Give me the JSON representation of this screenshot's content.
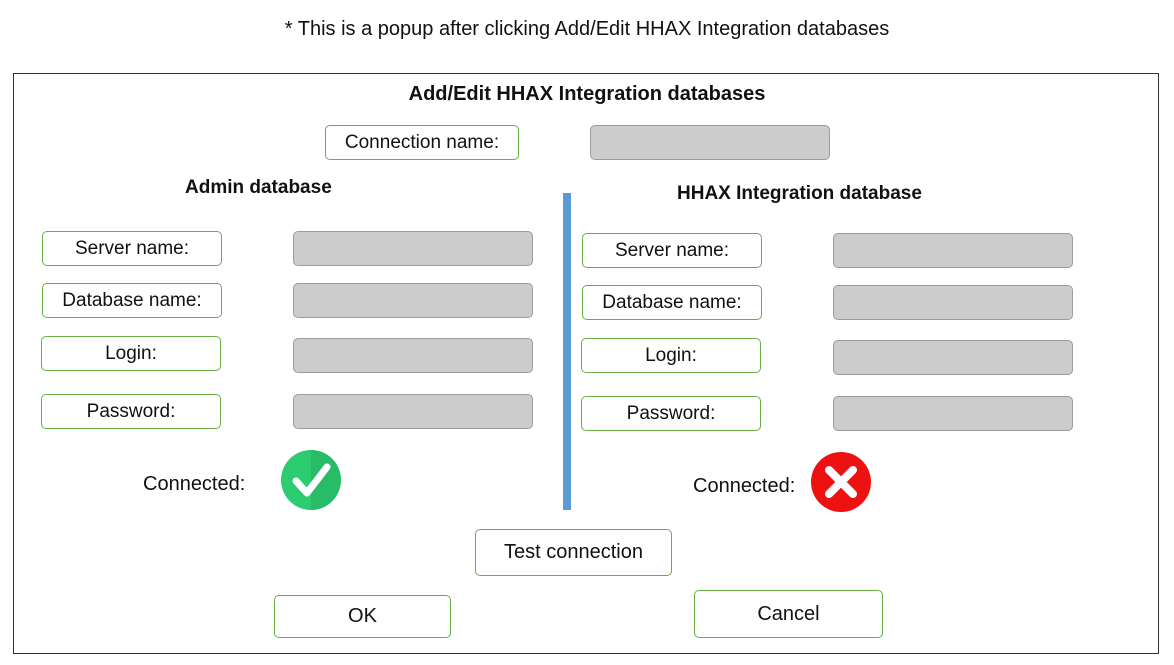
{
  "note": "* This is a popup after clicking Add/Edit HHAX Integration databases",
  "dialog": {
    "title": "Add/Edit HHAX Integration databases",
    "connection_name_label": "Connection name:",
    "connection_name_value": ""
  },
  "admin": {
    "title": "Admin database",
    "server_label": "Server name:",
    "database_label": "Database name:",
    "login_label": "Login:",
    "password_label": "Password:",
    "connected_label": "Connected:",
    "status_icon": "check-icon",
    "status_color": "#2ecc71"
  },
  "hhax": {
    "title": "HHAX Integration database",
    "server_label": "Server name:",
    "database_label": "Database name:",
    "login_label": "Login:",
    "password_label": "Password:",
    "connected_label": "Connected:",
    "status_icon": "cross-icon",
    "status_color": "#ee1111"
  },
  "buttons": {
    "test_connection": "Test connection",
    "ok": "OK",
    "cancel": "Cancel"
  },
  "colors": {
    "accent_border": "#6aaf44",
    "divider": "#5b9bd5",
    "field_fill": "#cccccc"
  }
}
